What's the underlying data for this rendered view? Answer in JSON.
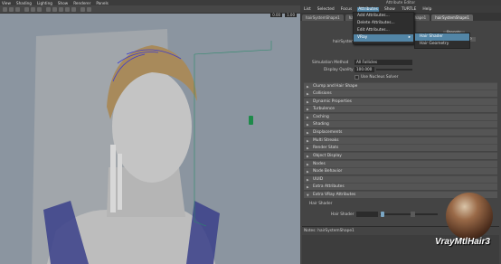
{
  "viewport": {
    "menu": [
      "View",
      "Shading",
      "Lighting",
      "Show",
      "Renderer",
      "Panels"
    ],
    "fields": [
      "0.00",
      "1.00"
    ]
  },
  "attribute_editor": {
    "title": "Attribute Editor",
    "menu": [
      "List",
      "Selected",
      "Focus",
      "Attributes",
      "Show",
      "TURTLE",
      "Help"
    ],
    "tabs": [
      "hairSystemShape1",
      "hairSystemShape1",
      "hairSystemShape1",
      "hairSystemShape1"
    ],
    "hair_system_label": "hairSystem:",
    "focus_button": "Focus",
    "presets_button": "Presets",
    "show_button": "Show",
    "hide_button": "Hide",
    "simulation_method_label": "Simulation Method",
    "simulation_method_value": "All Follicles",
    "display_quality_label": "Display Quality",
    "display_quality_value": "100.000",
    "use_nucleus_solver": "Use Nucleus Solver",
    "sections": [
      "Clump and Hair Shape",
      "Collisions",
      "Dynamic Properties",
      "Turbulence",
      "Caching",
      "Shading",
      "Displacements",
      "Multi Streaks",
      "Render Stats",
      "Object Display",
      "Nodes",
      "Node Behavior",
      "UUID",
      "Extra Attributes",
      "Extra VRay Attributes"
    ],
    "hair_shader_header": "Hair Shader",
    "hair_shader_label": "Hair Shader",
    "notes_label": "Notes: hairSystemShape1",
    "material_name": "VrayMtlHair3"
  },
  "attributes_menu": {
    "items": [
      "Add Attributes...",
      "Delete Attributes...",
      "Edit Attributes...",
      "VRay"
    ],
    "selected": "VRay"
  },
  "vray_submenu": {
    "items": [
      "Hair Shader",
      "Hair Geometry"
    ],
    "selected": "Hair Shader"
  }
}
